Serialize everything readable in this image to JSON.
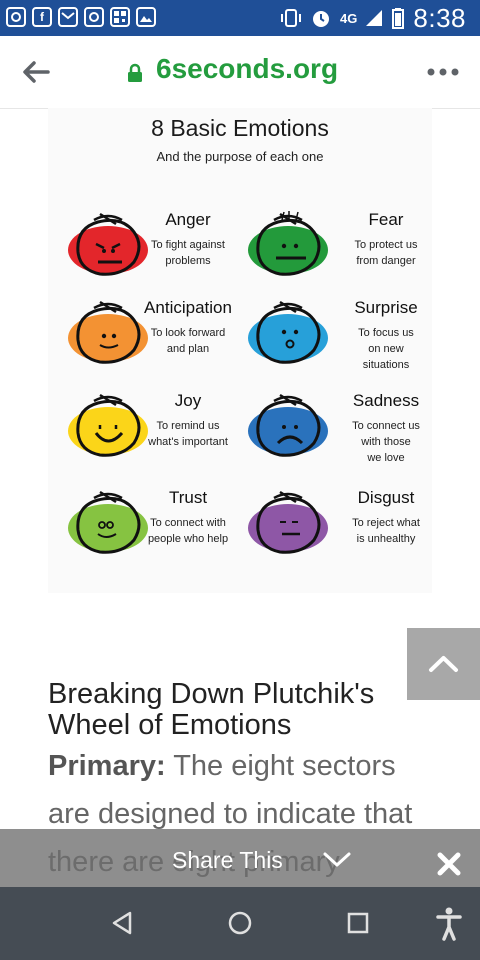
{
  "status_bar": {
    "time": "8:38",
    "network": "4G",
    "notification_icons": [
      "instagram-icon",
      "facebook-icon",
      "gmail-icon",
      "instagram-icon",
      "qr-icon",
      "gallery-icon"
    ],
    "system_icons": [
      "vibrate-icon",
      "alarm-icon",
      "signal-icon",
      "battery-icon"
    ]
  },
  "browser": {
    "url": "6seconds.org",
    "back_icon": "back-arrow-icon",
    "lock_icon": "lock-icon",
    "menu_icon": "more-vert-icon"
  },
  "infographic": {
    "title": "8 Basic Emotions",
    "subtitle": "And the purpose of each one",
    "emotions": [
      {
        "name": "Anger",
        "purpose_lines": [
          "To fight against",
          "problems"
        ],
        "color": "#e3262b"
      },
      {
        "name": "Fear",
        "purpose_lines": [
          "To protect us",
          "from danger"
        ],
        "color": "#239a3b"
      },
      {
        "name": "Anticipation",
        "purpose_lines": [
          "To look forward",
          "and plan"
        ],
        "color": "#f39233"
      },
      {
        "name": "Surprise",
        "purpose_lines": [
          "To focus us",
          "on new",
          "situations"
        ],
        "color": "#27a0d9"
      },
      {
        "name": "Joy",
        "purpose_lines": [
          "To remind us",
          "what's important"
        ],
        "color": "#fbd519"
      },
      {
        "name": "Sadness",
        "purpose_lines": [
          "To connect us",
          "with those",
          "we love"
        ],
        "color": "#2a72bc"
      },
      {
        "name": "Trust",
        "purpose_lines": [
          "To connect with",
          "people who help"
        ],
        "color": "#86c341"
      },
      {
        "name": "Disgust",
        "purpose_lines": [
          "To reject what",
          "is unhealthy"
        ],
        "color": "#8e57a6"
      }
    ]
  },
  "article": {
    "heading": "Breaking Down Plutchik's Wheel of Emotions",
    "paragraph_bold": "Primary:",
    "paragraph_text": " The eight sectors are designed to indicate that there are eight primary"
  },
  "scroll_top_icon": "chevron-up-icon",
  "share_bar": {
    "label": "Share This",
    "chevron_icon": "chevron-down-icon",
    "close_icon": "close-icon"
  },
  "nav_bar": {
    "icons": [
      "back-triangle-icon",
      "home-circle-icon",
      "recents-square-icon",
      "accessibility-icon"
    ]
  },
  "colors": {
    "status_bar": "#1f4f97",
    "url_green": "#249c3e",
    "nav_bar": "#454c54"
  }
}
